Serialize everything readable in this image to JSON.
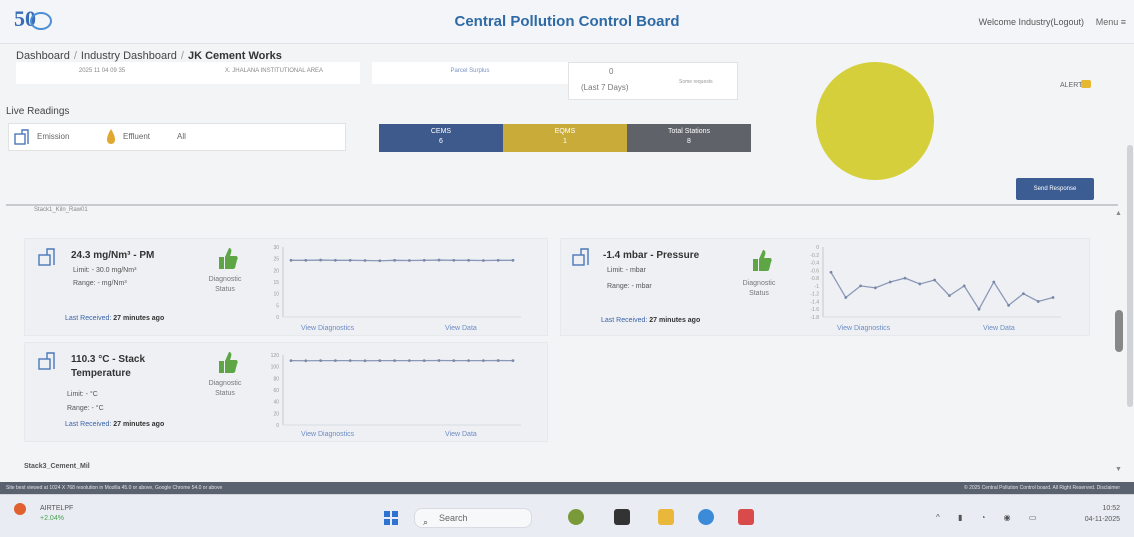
{
  "header": {
    "logo_text": "50",
    "title": "Central Pollution Control Board",
    "welcome": "Welcome Industry(Logout)",
    "menu": "Menu ≡"
  },
  "breadcrumb": [
    {
      "label": "Dashboard"
    },
    {
      "label": "Industry Dashboard"
    },
    {
      "label": "JK Cement Works"
    }
  ],
  "info": {
    "date": "2025 11 04 09 35",
    "area": "X. JHALANA INSTITUTIONAL AREA",
    "report": "Parcel Surplus",
    "count_value": "0",
    "count_period": "(Last 7 Days)",
    "count_note": "Some requests",
    "status": "ALERTS"
  },
  "live": {
    "title": "Live Readings",
    "filters": [
      "Emission",
      "Effluent",
      "All"
    ],
    "tiles": [
      {
        "label": "CEMS",
        "value": "6",
        "color": "#3e5a8c"
      },
      {
        "label": "EQMS",
        "value": "1",
        "color": "#c9ab3a"
      },
      {
        "label": "Total Stations",
        "value": "8",
        "color": "#5f6268"
      }
    ],
    "send_button": "Send Response"
  },
  "stack_top_label": "Stack1_Kiln_Raw01",
  "readings": [
    {
      "title": "24.3 mg/Nm³ - PM",
      "limit": "Limit: - 30.0 mg/Nm³",
      "range": "Range: - mg/Nm³",
      "diag": "Diagnostic Status",
      "last": "Last Received:",
      "ago": "27 minutes ago",
      "view_diag": "View Diagnostics",
      "view_data": "View Data"
    },
    {
      "title": "-1.4 mbar - Pressure",
      "limit": "Limit: - mbar",
      "range": "Range: - mbar",
      "diag": "Diagnostic Status",
      "last": "Last Received:",
      "ago": "27 minutes ago",
      "view_diag": "View Diagnostics",
      "view_data": "View Data"
    },
    {
      "title": "110.3 °C - Stack Temperature",
      "limit": "Limit: - °C",
      "range": "Range: - °C",
      "diag": "Diagnostic Status",
      "last": "Last Received:",
      "ago": "27 minutes ago",
      "view_diag": "View Diagnostics",
      "view_data": "View Data"
    }
  ],
  "charts": {
    "pm": {
      "type": "line",
      "ylim": [
        0,
        30
      ],
      "ticks": [
        "30",
        "25",
        "20",
        "15",
        "10",
        "5",
        "0"
      ],
      "values": [
        24.3,
        24.3,
        24.4,
        24.3,
        24.3,
        24.2,
        24.1,
        24.3,
        24.2,
        24.3,
        24.4,
        24.3,
        24.3,
        24.2,
        24.3,
        24.3
      ]
    },
    "pressure": {
      "type": "line",
      "ylim": [
        -1.8,
        0
      ],
      "ticks": [
        "0",
        "-0.2",
        "-0.4",
        "-0.6",
        "-0.8",
        "-1",
        "-1.2",
        "-1.4",
        "-1.6",
        "-1.8"
      ],
      "values": [
        -0.65,
        -1.3,
        -1.0,
        -1.05,
        -0.9,
        -0.8,
        -0.95,
        -0.85,
        -1.25,
        -1.0,
        -1.6,
        -0.9,
        -1.5,
        -1.2,
        -1.4,
        -1.3
      ]
    },
    "temp": {
      "type": "line",
      "ylim": [
        0,
        120
      ],
      "ticks": [
        "120",
        "100",
        "80",
        "60",
        "40",
        "20",
        "0"
      ],
      "values": [
        110.3,
        110.2,
        110.4,
        110.3,
        110.3,
        110.2,
        110.4,
        110.3,
        110.3,
        110.4,
        110.6,
        110.4,
        110.3,
        110.3,
        110.5,
        110.3
      ]
    }
  },
  "stack_bottom_label": "Stack3_Cement_Mil",
  "footer": {
    "left": "Site best viewed at 1024 X 768 resolution in Mozilla 45.0 or above, Google Chrome 54.0 or above",
    "right": "© 2025 Central Pollution Control board. All Right Reserved. Disclaimer"
  },
  "taskbar": {
    "weather_name": "AIRTELPF",
    "weather_change": "+2.04%",
    "search": "Search",
    "time": "10:52",
    "date": "04-11-2025"
  },
  "colors": {
    "accent": "#2e6aa6",
    "thumb": "#5ea645",
    "line": "#8b98b6"
  }
}
